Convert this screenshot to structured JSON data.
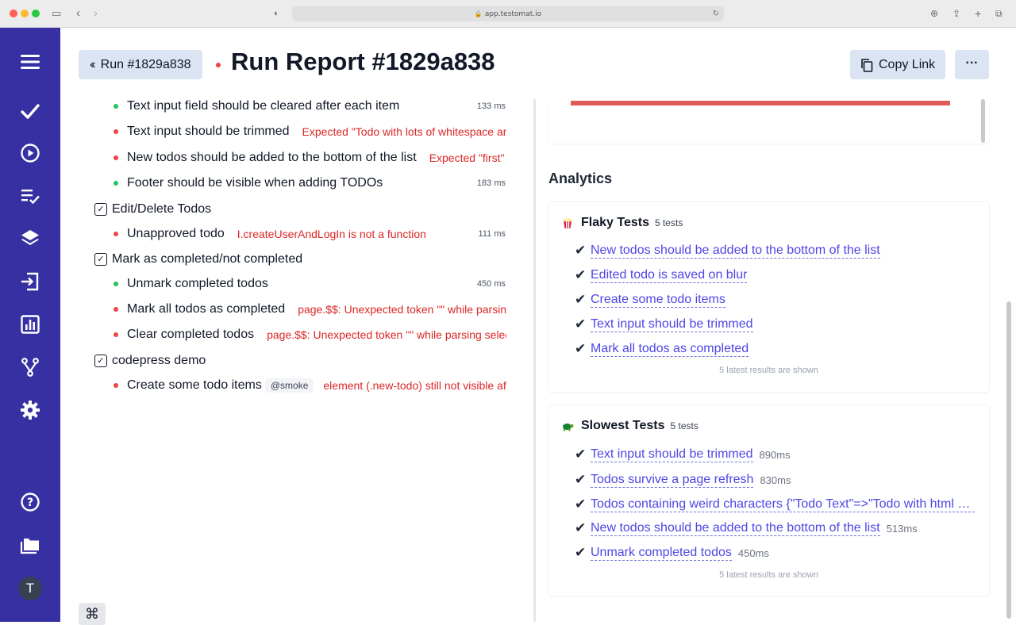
{
  "browser": {
    "url": "app.testomat.io"
  },
  "sidebar": {
    "avatar_initial": "T"
  },
  "header": {
    "back_label": "Run #1829a838",
    "title": "Run Report #1829a838",
    "copy_label": "Copy Link",
    "more_label": "···"
  },
  "tests": {
    "rows": [
      {
        "name": "Text input field should be cleared after each item",
        "status": "passed",
        "duration": "133 ms",
        "error": ""
      },
      {
        "name": "Text input should be trimmed",
        "status": "failed",
        "duration": "",
        "error": "Expected \"Todo with lots of whitespace around\""
      },
      {
        "name": "New todos should be added to the bottom of the list",
        "status": "failed",
        "duration": "",
        "error": "Expected \"first\" but"
      },
      {
        "name": "Footer should be visible when adding TODOs",
        "status": "passed",
        "duration": "183 ms",
        "error": ""
      }
    ],
    "suite_edit": "Edit/Delete Todos",
    "edit_rows": [
      {
        "name": "Unapproved todo",
        "status": "failed",
        "duration": "111 ms",
        "error": "I.createUserAndLogIn is not a function"
      }
    ],
    "suite_mark": "Mark as completed/not completed",
    "mark_rows": [
      {
        "name": "Unmark completed todos",
        "status": "passed",
        "duration": "450 ms",
        "error": ""
      },
      {
        "name": "Mark all todos as completed",
        "status": "failed",
        "duration": "",
        "error": "page.$$: Unexpected token \"\" while parsing selector"
      },
      {
        "name": "Clear completed todos",
        "status": "failed",
        "duration": "",
        "error": "page.$$: Unexpected token \"\" while parsing selector"
      }
    ],
    "suite_demo": "codepress demo",
    "demo_rows": [
      {
        "name": "Create some todo items",
        "status": "failed",
        "duration": "",
        "tag": "@smoke",
        "error": "element (.new-todo) still not visible after"
      }
    ]
  },
  "analytics": {
    "heading": "Analytics",
    "flaky": {
      "title": "Flaky Tests",
      "count": "5 tests",
      "items": [
        "New todos should be added to the bottom of the list",
        "Edited todo is saved on blur",
        "Create some todo items",
        "Text input should be trimmed",
        "Mark all todos as completed"
      ],
      "footer": "5 latest results are shown"
    },
    "slowest": {
      "title": "Slowest Tests",
      "count": "5 tests",
      "items": [
        {
          "name": "Text input should be trimmed",
          "time": "890ms"
        },
        {
          "name": "Todos survive a page refresh",
          "time": "830ms"
        },
        {
          "name": "Todos containing weird characters {\"Todo Text\"=>\"Todo with html code",
          "time": ""
        },
        {
          "name": "New todos should be added to the bottom of the list",
          "time": "513ms"
        },
        {
          "name": "Unmark completed todos",
          "time": "450ms"
        }
      ],
      "footer": "5 latest results are shown"
    }
  },
  "colors": {
    "sidebar": "#3730a3",
    "pass": "#22c55e",
    "fail": "#ef4444",
    "link": "#4f46e5"
  },
  "icons": {
    "sidebar": [
      "menu-icon",
      "check-icon",
      "play-circle-icon",
      "list-check-icon",
      "layers-icon",
      "import-icon",
      "bar-chart-icon",
      "branch-icon",
      "gear-icon",
      "help-icon",
      "folder-icon"
    ],
    "cmd": "⌘"
  }
}
